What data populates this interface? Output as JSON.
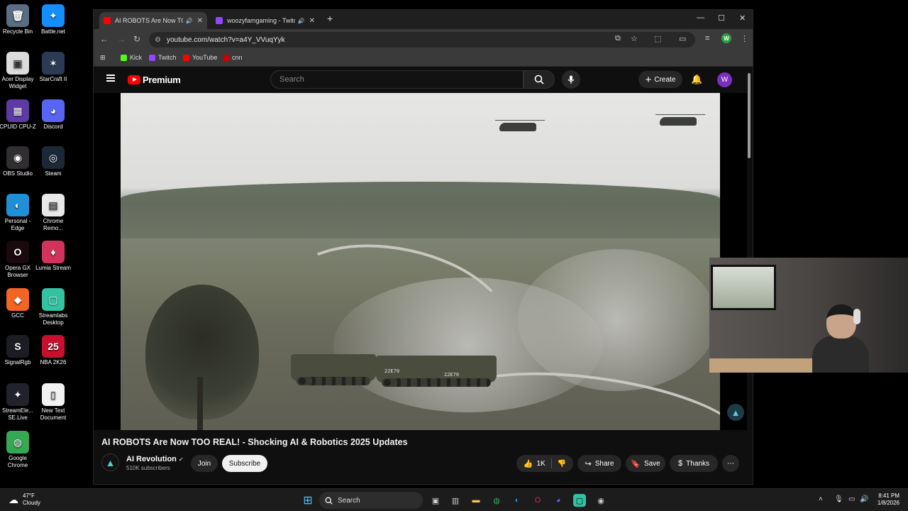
{
  "desktop": {
    "icons": [
      {
        "label": "Recycle Bin",
        "glyph": "🗑",
        "color": "#5a6d82"
      },
      {
        "label": "Battle.net",
        "glyph": "✦",
        "color": "#148eff"
      },
      {
        "label": "Acer Display Widget",
        "glyph": "▣",
        "color": "#dcdcdc"
      },
      {
        "label": "StarCraft II",
        "glyph": "✶",
        "color": "#2b3b55"
      },
      {
        "label": "CPUID CPU-Z",
        "glyph": "▦",
        "color": "#5e3aa6"
      },
      {
        "label": "Discord",
        "glyph": "◕",
        "color": "#5865f2"
      },
      {
        "label": "OBS Studio",
        "glyph": "◉",
        "color": "#302e31"
      },
      {
        "label": "Steam",
        "glyph": "◎",
        "color": "#1b2838"
      },
      {
        "label": "Personal - Edge",
        "glyph": "◐",
        "color": "#1f8fd6"
      },
      {
        "label": "Chrome Remo...",
        "glyph": "▤",
        "color": "#e8e8e8"
      },
      {
        "label": "Opera GX Browser",
        "glyph": "O",
        "color": "#1a0a0e"
      },
      {
        "label": "Lumia Stream",
        "glyph": "♦",
        "color": "#d2335a"
      },
      {
        "label": "GCC",
        "glyph": "◆",
        "color": "#f26522"
      },
      {
        "label": "Streamlabs Desktop",
        "glyph": "▢",
        "color": "#31c3a2"
      },
      {
        "label": "SignalRgb",
        "glyph": "S",
        "color": "#1c1c24"
      },
      {
        "label": "NBA 2K26",
        "glyph": "25",
        "color": "#c8102e"
      },
      {
        "label": "StreamEle... SE.Live",
        "glyph": "✦",
        "color": "#22222a"
      },
      {
        "label": "New Text Document",
        "glyph": "▯",
        "color": "#f2f2f2"
      },
      {
        "label": "Google Chrome",
        "glyph": "◍",
        "color": "#34a853"
      }
    ]
  },
  "browser": {
    "tabs": [
      {
        "title": "AI ROBOTS Are Now TOO R",
        "favicon_color": "#ff0000",
        "active": true
      },
      {
        "title": "woozyfamgaming - Twitch",
        "favicon_color": "#9146ff",
        "active": false
      }
    ],
    "new_tab": "+",
    "url": "youtube.com/watch?v=a4Y_VVuqYyk",
    "profile_initial": "W",
    "bookmarks": [
      {
        "label": "Kick",
        "color": "#53fc18"
      },
      {
        "label": "Twitch",
        "color": "#9146ff"
      },
      {
        "label": "YouTube",
        "color": "#ff0000"
      },
      {
        "label": "cnn",
        "color": "#cc0000"
      }
    ]
  },
  "youtube": {
    "brand": "Premium",
    "search_placeholder": "Search",
    "create_label": "Create",
    "avatar_initial": "W",
    "video_title": "AI ROBOTS Are Now TOO REAL! - Shocking AI & Robotics 2025 Updates",
    "channel_name": "AI Revolution",
    "subscribers": "510K subscribers",
    "join_label": "Join",
    "subscribe_label": "Subscribe",
    "likes": "1K",
    "share_label": "Share",
    "save_label": "Save",
    "thanks_label": "Thanks",
    "vehicle_label_1": "22E70",
    "vehicle_label_2": "22E70"
  },
  "taskbar": {
    "weather_temp": "47°F",
    "weather_desc": "Cloudy",
    "search_label": "Search",
    "time": "8:41 PM",
    "date": "1/8/2026"
  }
}
